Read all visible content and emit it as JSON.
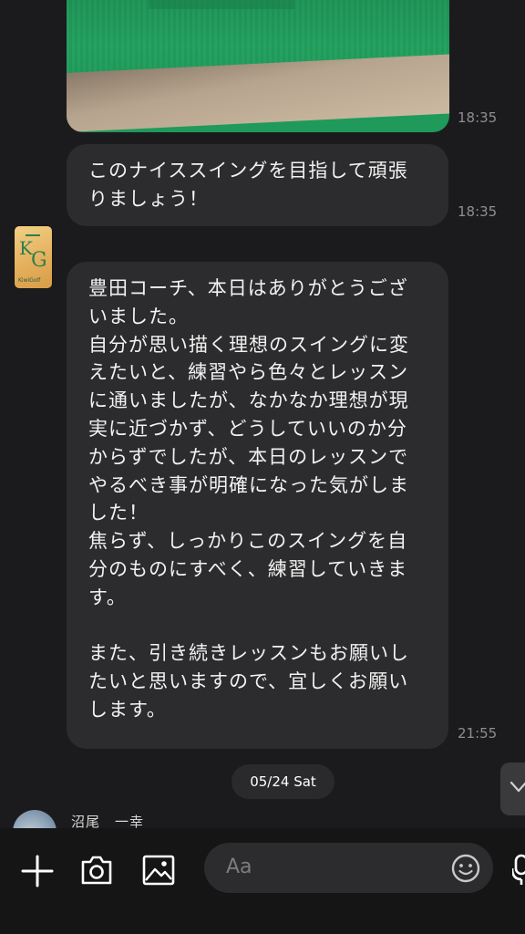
{
  "messages": {
    "image_time": "18:35",
    "msg1_text": "このナイススイングを目指して頑張りましょう！",
    "msg1_time": "18:35",
    "msg2_text": "豊田コーチ、本日はありがとうございました。\n自分が思い描く理想のスイングに変えたいと、練習やら色々とレッスンに通いましたが、なかなか理想が現実に近づかず、どうしていいのか分からずでしたが、本日のレッスンでやるべき事が明確になった気がしました！\n焦らず、しっかりこのスイングを自分のものにすべく、練習していきます。\n\nまた、引き続きレッスンもお願いしたいと思いますので、宜しくお願いします。",
    "msg2_time": "21:55"
  },
  "avatar": {
    "brand": "KiwiGolf",
    "initials_k": "K",
    "initials_g": "G"
  },
  "date_divider": "05/24 Sat",
  "next_sender": {
    "name": "沼尾　一幸"
  },
  "composer": {
    "placeholder": "Aa"
  },
  "icons": {
    "add": "plus-icon",
    "camera": "camera-icon",
    "gallery": "image-icon",
    "emoji": "emoji-icon",
    "mic": "microphone-icon",
    "scroll": "chevron-down-icon"
  },
  "colors": {
    "background": "#1b1b1d",
    "bubble": "#2c2c2e",
    "timestamp": "#8e8e93",
    "footer": "#151515"
  }
}
